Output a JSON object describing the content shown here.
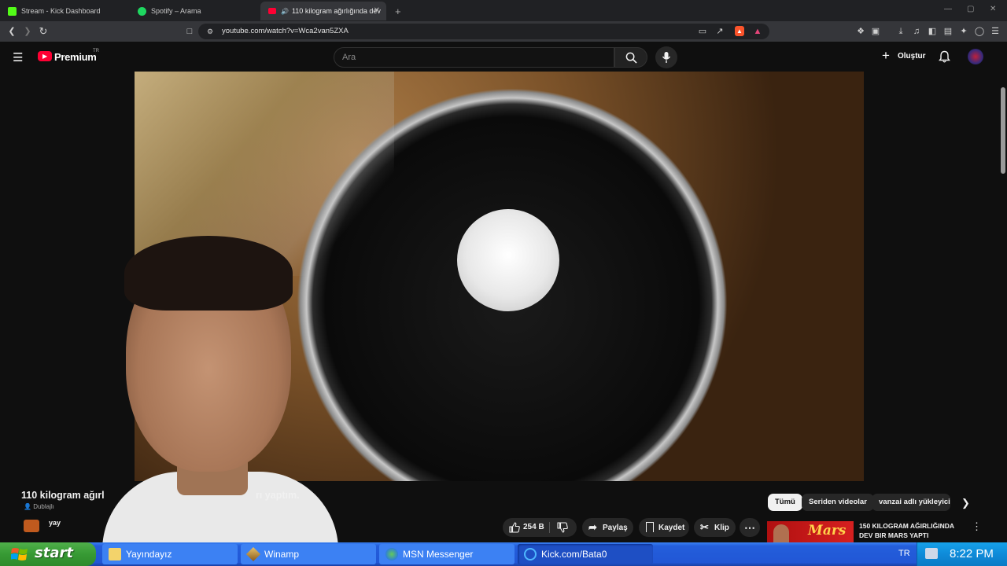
{
  "browser": {
    "tabs": [
      {
        "label": "Stream - Kick Dashboard",
        "favicon_color": "#53fc18"
      },
      {
        "label": "Spotify – Arama",
        "favicon_color": "#1ed760"
      },
      {
        "label": "110 kilogram ağırlığında dev",
        "favicon_color": "#ff0033"
      }
    ],
    "new_tab": "+",
    "url": "youtube.com/watch?v=Wca2van5ZXA"
  },
  "youtube": {
    "logo_text": "Premium",
    "region": "TR",
    "search_placeholder": "Ara",
    "create_label": "Oluştur",
    "video": {
      "title_start": "110 kilogram ağırl",
      "title_end": "rı yaptım.",
      "dubbed_label": "Dublajlı",
      "channel_fragment": "yay",
      "likes": "254 B",
      "share_label": "Paylaş",
      "save_label": "Kaydet",
      "clip_label": "Klip"
    },
    "chips": [
      "Tümü",
      "Seriden videolar",
      "vanzai adlı yükleyicid"
    ],
    "recommendation": {
      "thumb_brand": "Mars",
      "title": "150 KILOGRAM AĞIRLIĞINDA DEV BIR MARS YAPTI"
    }
  },
  "taskbar": {
    "start_label": "start",
    "buttons": [
      "Yayındayız",
      "Winamp",
      "MSN Messenger",
      "Kick.com/Bata0"
    ],
    "language": "TR",
    "clock": "8:22 PM"
  }
}
